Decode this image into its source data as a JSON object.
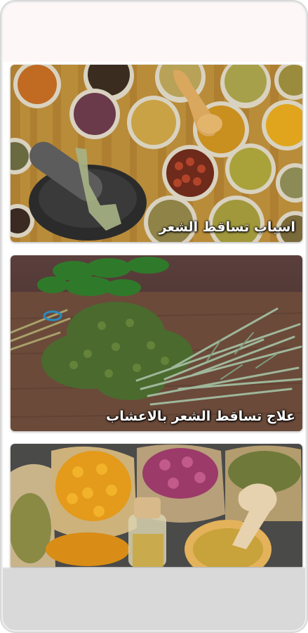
{
  "cards": [
    {
      "title": "اسباب تساقط الشعر"
    },
    {
      "title": "علاج تساقط الشعر بالاعشاب"
    },
    {
      "title": ""
    }
  ]
}
